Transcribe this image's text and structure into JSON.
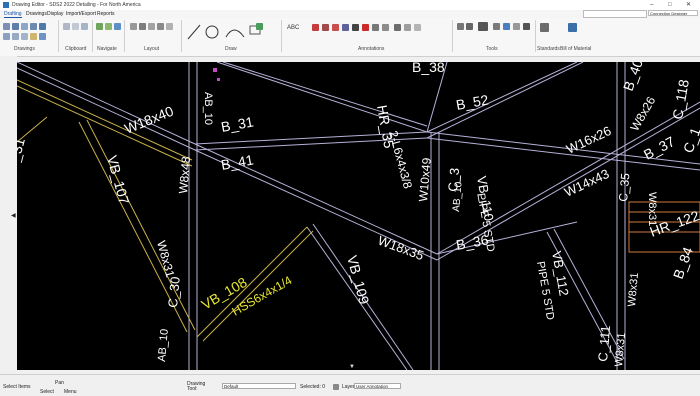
{
  "window": {
    "title": "Drawing Editor - SDS2 2022 Detailing - For North America"
  },
  "menu": {
    "tabs": [
      "Drafting",
      "Drawings",
      "Display",
      "Import/Export",
      "Reports"
    ]
  },
  "top_right": {
    "search_placeholder": "",
    "connection_combo": "Connection Designer"
  },
  "ribbon": {
    "groups": {
      "drawings": "Drawings",
      "clipboard": "Clipboard",
      "navigate": "Navigate",
      "layout": "Layout",
      "draw": "Draw",
      "annotations": "Annotations",
      "tools": "Tools",
      "standards": "Standards",
      "bom": "Bill of Material"
    },
    "abc_label": "ABC"
  },
  "model_labels": {
    "b38": "B_38",
    "b52": "B_52",
    "b40": "B_40",
    "c118": "C_118",
    "w18x40": "W18x40",
    "b31": "B_31",
    "hr35": "HR_35",
    "l6x4": "2-L6x4x3/8",
    "w8x26": "W8x26",
    "ab_top": "AB_10",
    "w8x48": "W8x48",
    "b41": "B_41",
    "w10x49": "W10x49",
    "c3": "C_3",
    "vb110": "VB_110",
    "pipe5": "PIPE 5 STD",
    "w16x26": "W16x26",
    "b37": "B_37",
    "c1": "C_1",
    "w14x43": "W14x43",
    "c35": "C_35",
    "w8x31r": "W8x31",
    "hr122": "HR_122",
    "b84": "B_84",
    "w8x31r2": "W8x31",
    "vb107": "VB_107",
    "c31": "_31",
    "w18x35": "W18x35",
    "b36": "B_36",
    "vb112": "VB_112",
    "pipe5b": "PIPE 5 STD",
    "vb109": "VB_109",
    "w8x31l": "W8x31",
    "c30": "C_30",
    "vb108": "VB_108",
    "hss": "HSS6x4x1/4",
    "ab10": "AB_10",
    "ab10c": "AB_10",
    "c111": "C_111",
    "w8x31b": "W8x31"
  },
  "status": {
    "select_items": "Select Items",
    "pan": "Pan",
    "select": "Select",
    "menu": "Menu",
    "drawing_tool_label": "Drawing Tool:",
    "drawing_tool_value": "Default",
    "selected_label": "Selected: 0",
    "layer_label": "Layer:",
    "layer_value": "User Annotation"
  },
  "colors": {
    "beam": "#b8b0d8",
    "yellow": "#e8e832",
    "accent": "#1a56a8",
    "brace": "#c9b04a"
  }
}
